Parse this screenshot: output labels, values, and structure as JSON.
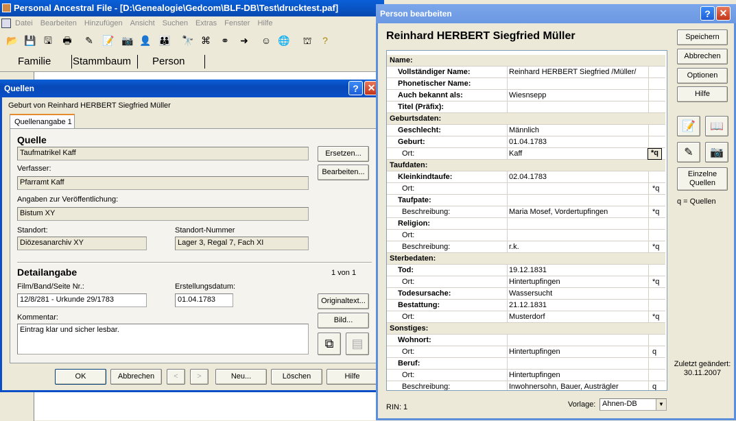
{
  "main": {
    "title": "Personal Ancestral File - [D:\\Genealogie\\Gedcom\\BLF-DB\\Test\\drucktest.paf]",
    "menu": [
      "Datei",
      "Bearbeiten",
      "Hinzufügen",
      "Ansicht",
      "Suchen",
      "Extras",
      "Fenster",
      "Hilfe"
    ],
    "tabs": [
      "Familie",
      "Stammbaum",
      "Person"
    ]
  },
  "quellen": {
    "title": "Quellen",
    "subtitle": "Geburt von Reinhard HERBERT Siegfried Müller",
    "tab": "Quellenangabe 1",
    "quelle_heading": "Quelle",
    "quelle_value": "Taufmatrikel Kaff",
    "verfasser_label": "Verfasser:",
    "verfasser_value": "Pfarramt Kaff",
    "angaben_label": "Angaben zur Veröffentlichung:",
    "angaben_value": "Bistum XY",
    "standort_label": "Standort:",
    "standort_value": "Diözesanarchiv XY",
    "standort_nr_label": "Standort-Nummer",
    "standort_nr_value": "Lager 3, Regal 7, Fach XI",
    "detail_heading": "Detailangabe",
    "count": "1 von 1",
    "film_label": "Film/Band/Seite Nr.:",
    "film_value": "12/8/281 - Urkunde 29/1783",
    "datum_label": "Erstellungsdatum:",
    "datum_value": "01.04.1783",
    "kommentar_label": "Kommentar:",
    "kommentar_value": "Eintrag klar und sicher lesbar.",
    "btn_ersetzen": "Ersetzen...",
    "btn_bearbeiten": "Bearbeiten...",
    "btn_originaltext": "Originaltext...",
    "btn_bild": "Bild...",
    "btn_ok": "OK",
    "btn_abbrechen": "Abbrechen",
    "btn_prev": "<",
    "btn_next": ">",
    "btn_neu": "Neu...",
    "btn_loeschen": "Löschen",
    "btn_hilfe": "Hilfe"
  },
  "person": {
    "title": "Person bearbeiten",
    "name": "Reinhard HERBERT Siegfried Müller",
    "rin": "RIN: 1",
    "vorlage_label": "Vorlage:",
    "vorlage_value": "Ahnen-DB",
    "btn_speichern": "Speichern",
    "btn_abbrechen": "Abbrechen",
    "btn_optionen": "Optionen",
    "btn_hilfe": "Hilfe",
    "btn_einzelne": "Einzelne Quellen",
    "q_legend": "q = Quellen",
    "zuletzt": "Zuletzt geändert: 30.11.2007",
    "rows": [
      {
        "t": "s",
        "label": "Name:"
      },
      {
        "t": "b",
        "label": "Vollständiger Name:",
        "value": "Reinhard HERBERT Siegfried /Müller/",
        "q": ""
      },
      {
        "t": "b",
        "label": "Phonetischer Name:",
        "value": "",
        "q": ""
      },
      {
        "t": "b",
        "label": "Auch bekannt als:",
        "value": "Wiesnsepp",
        "q": ""
      },
      {
        "t": "b",
        "label": "Titel (Präfix):",
        "value": "",
        "q": ""
      },
      {
        "t": "s",
        "label": "Geburtsdaten:"
      },
      {
        "t": "b",
        "label": "Geschlecht:",
        "value": "Männlich",
        "q": ""
      },
      {
        "t": "b",
        "label": "Geburt:",
        "value": "01.04.1783",
        "q": ""
      },
      {
        "t": "n",
        "label": "Ort:",
        "value": "Kaff",
        "q": "*q"
      },
      {
        "t": "s",
        "label": "Taufdaten:"
      },
      {
        "t": "b",
        "label": "Kleinkindtaufe:",
        "value": "02.04.1783",
        "q": ""
      },
      {
        "t": "n",
        "label": "Ort:",
        "value": "",
        "q": "*q"
      },
      {
        "t": "b",
        "label": "Taufpate:",
        "value": "",
        "q": ""
      },
      {
        "t": "n",
        "label": "Beschreibung:",
        "value": "Maria Mosef, Vordertupfingen",
        "q": "*q"
      },
      {
        "t": "b",
        "label": "Religion:",
        "value": "",
        "q": ""
      },
      {
        "t": "n",
        "label": "Ort:",
        "value": "",
        "q": ""
      },
      {
        "t": "n",
        "label": "Beschreibung:",
        "value": "r.k.",
        "q": "*q"
      },
      {
        "t": "s",
        "label": "Sterbedaten:"
      },
      {
        "t": "b",
        "label": "Tod:",
        "value": "19.12.1831",
        "q": ""
      },
      {
        "t": "n",
        "label": "Ort:",
        "value": "Hintertupfingen",
        "q": "*q"
      },
      {
        "t": "b",
        "label": "Todesursache:",
        "value": "Wassersucht",
        "q": ""
      },
      {
        "t": "b",
        "label": "Bestattung:",
        "value": "21.12.1831",
        "q": ""
      },
      {
        "t": "n",
        "label": "Ort:",
        "value": "Musterdorf",
        "q": "*q"
      },
      {
        "t": "s",
        "label": "Sonstiges:"
      },
      {
        "t": "b",
        "label": "Wohnort:",
        "value": "",
        "q": ""
      },
      {
        "t": "n",
        "label": "Ort:",
        "value": "Hintertupfingen",
        "q": "q"
      },
      {
        "t": "b",
        "label": "Beruf:",
        "value": "",
        "q": ""
      },
      {
        "t": "n",
        "label": "Ort:",
        "value": "Hintertupfingen",
        "q": ""
      },
      {
        "t": "n",
        "label": "Beschreibung:",
        "value": "Inwohnersohn, Bauer, Austrägler",
        "q": "q"
      }
    ]
  }
}
